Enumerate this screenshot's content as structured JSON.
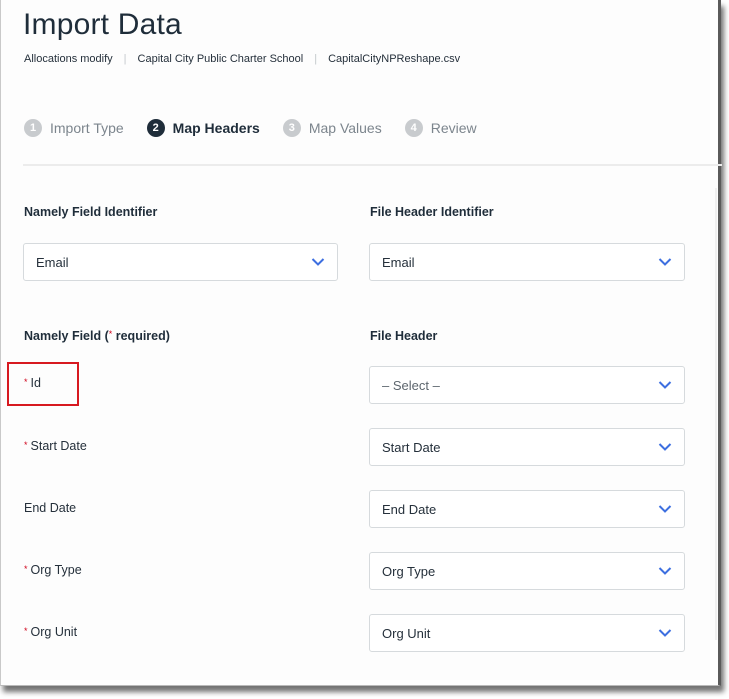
{
  "page": {
    "title": "Import Data",
    "breadcrumb": [
      "Allocations modify",
      "Capital City Public Charter School",
      "CapitalCityNPReshape.csv"
    ],
    "breadcrumb_separator": "|"
  },
  "steps": [
    {
      "number": "1",
      "label": "Import Type",
      "state": "inactive"
    },
    {
      "number": "2",
      "label": "Map Headers",
      "state": "active"
    },
    {
      "number": "3",
      "label": "Map Values",
      "state": "inactive"
    },
    {
      "number": "4",
      "label": "Review",
      "state": "inactive"
    }
  ],
  "identifier": {
    "namely_header": "Namely Field Identifier",
    "file_header": "File Header Identifier",
    "namely_value": "Email",
    "file_value": "Email"
  },
  "mapping": {
    "namely_header_prefix": "Namely Field (",
    "required_marker": "*",
    "namely_header_suffix": " required)",
    "file_header": "File Header",
    "rows": [
      {
        "field": "Id",
        "required": true,
        "value": "– Select –",
        "is_placeholder": true,
        "highlighted": true
      },
      {
        "field": "Start Date",
        "required": true,
        "value": "Start Date",
        "is_placeholder": false
      },
      {
        "field": "End Date",
        "required": false,
        "value": "End Date",
        "is_placeholder": false
      },
      {
        "field": "Org Type",
        "required": true,
        "value": "Org Type",
        "is_placeholder": false
      },
      {
        "field": "Org Unit",
        "required": true,
        "value": "Org Unit",
        "is_placeholder": false
      }
    ]
  },
  "icons": {
    "dropdown": "chevron-down-icon"
  },
  "colors": {
    "accent": "#3d6fe0",
    "required": "#d0021b",
    "highlight_box": "#d71920",
    "active_step": "#1f2d3a",
    "inactive_step": "#c8cbce"
  }
}
